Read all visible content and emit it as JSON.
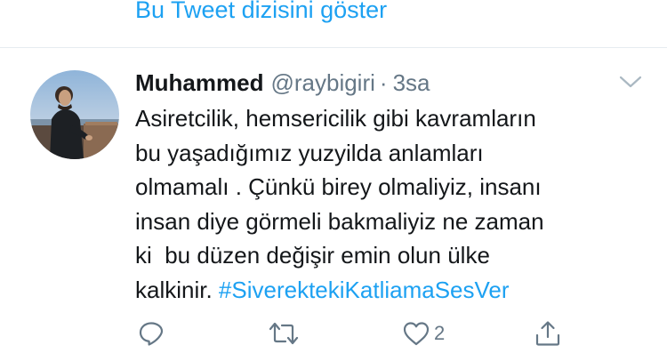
{
  "thread": {
    "show_thread_label": "Bu Tweet dizisini göster"
  },
  "tweet": {
    "display_name": "Muhammed",
    "handle": "@raybigiri",
    "separator": "·",
    "time": "3sa",
    "text_lines": [
      "Asiretcilik, hemsericilik gibi kavramların",
      "bu yaşadığımız yuzyilda anlamları",
      "olmamalı . Çünkü birey olmaliyiz, insanı",
      "insan diye görmeli bakmaliyiz ne zaman",
      "ki  bu düzen değişir emin olun ülke",
      "kalkinir. "
    ],
    "hashtag": "#SiverektekiKatliamaSesVer",
    "like_count": "2"
  },
  "icons": {
    "reply": "reply-icon",
    "retweet": "retweet-icon",
    "like": "heart-icon",
    "share": "share-icon",
    "caret": "chevron-down-icon"
  },
  "colors": {
    "link": "#1da1f2",
    "text": "#14171a",
    "secondary": "#657786",
    "divider": "#e6ecf0"
  }
}
